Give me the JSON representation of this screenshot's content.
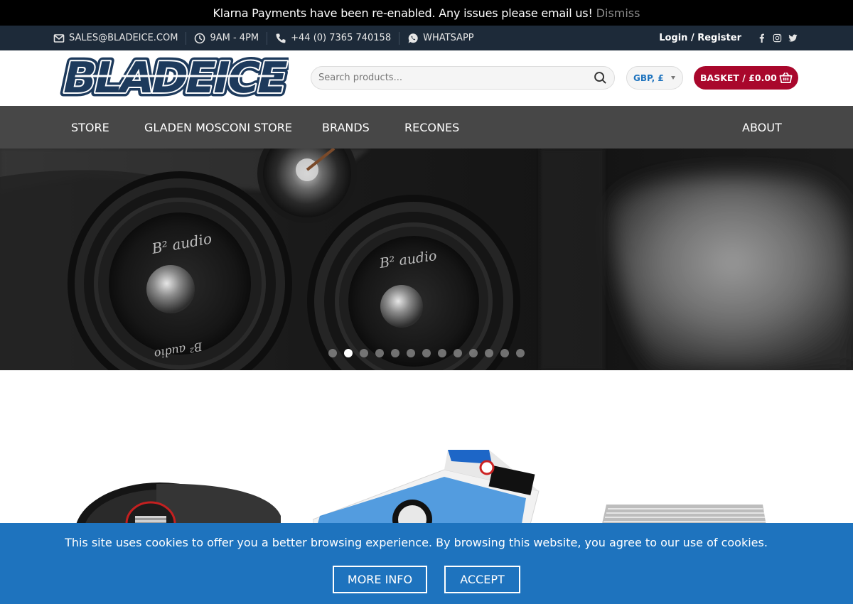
{
  "notice": {
    "message": "Klarna Payments have been re-enabled. Any issues please email us!",
    "dismiss_label": "Dismiss"
  },
  "topbar": {
    "email": "SALES@BLADEICE.COM",
    "hours": "9AM - 4PM",
    "phone": "+44 (0) 7365 740158",
    "whatsapp": "WHATSAPP",
    "login": "Login / Register",
    "social_icons": [
      "facebook-icon",
      "instagram-icon",
      "twitter-icon"
    ]
  },
  "header": {
    "logo_text": "BLADEICE",
    "search_placeholder": "Search products...",
    "currency": "GBP, £",
    "basket_label": "BASKET / £0.00"
  },
  "nav": {
    "items": [
      "STORE",
      "GLADEN MOSCONI STORE",
      "BRANDS",
      "RECONES"
    ],
    "right_item": "ABOUT"
  },
  "hero": {
    "brand_mark": "B² audio",
    "slide_count": 13,
    "active_slide": 2
  },
  "cookie": {
    "text": "This site uses cookies to offer you a better browsing experience. By browsing this website, you agree to our use of cookies.",
    "more_info": "MORE INFO",
    "accept": "ACCEPT"
  },
  "colors": {
    "notice_bg": "#000000",
    "topbar_bg": "#1d2a39",
    "nav_bg": "#474747",
    "basket_bg": "#a9072c",
    "cookie_bg": "#1e73be",
    "currency_text": "#1e73be"
  }
}
